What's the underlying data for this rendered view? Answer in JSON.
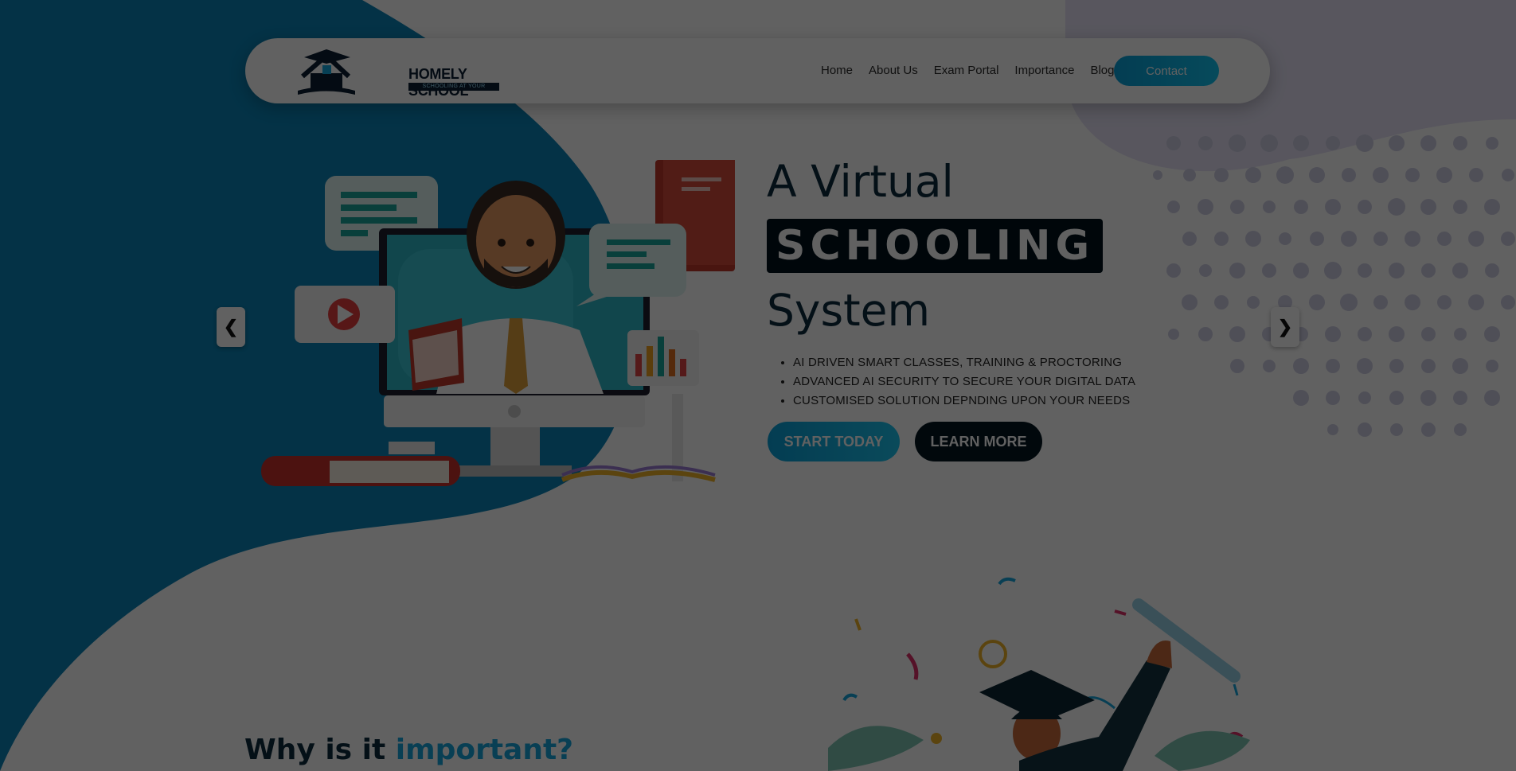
{
  "brand": {
    "name": "HOMELY SCHOOL",
    "tagline": "SCHOOLING AT YOUR DOORSTEP",
    "accent_color": "#0aa8e0",
    "dark_color": "#03131f"
  },
  "nav": {
    "links": [
      "Home",
      "About Us",
      "Exam Portal",
      "Importance",
      "Blogs"
    ],
    "contact_label": "Contact"
  },
  "hero": {
    "line1": "A Virtual",
    "highlight": "SCHOOLING",
    "line3": "System",
    "bullets": [
      "AI DRIVEN SMART CLASSES, TRAINING & PROCTORING",
      "ADVANCED AI SECURITY TO SECURE YOUR DIGITAL DATA",
      "CUSTOMISED SOLUTION DEPNDING UPON YOUR NEEDS"
    ],
    "start_label": "START TODAY",
    "learn_label": "LEARN MORE"
  },
  "carousel": {
    "prev_icon": "chevron-left-icon",
    "next_icon": "chevron-right-icon"
  },
  "section": {
    "title_prefix": "Why is it",
    "title_accent": "important?"
  },
  "overlay": {
    "dimmed": true
  }
}
